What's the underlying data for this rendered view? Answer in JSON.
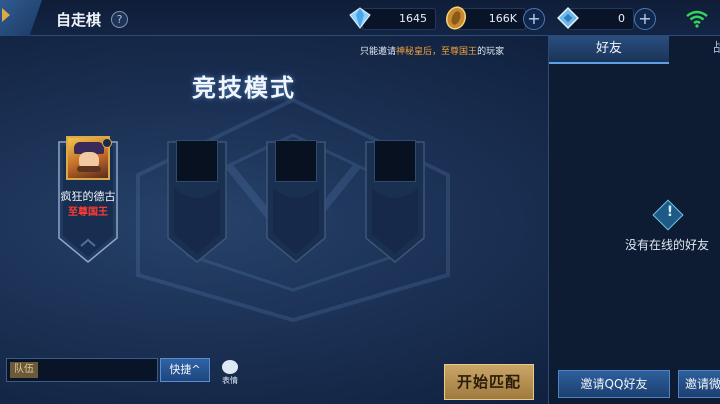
{
  "header": {
    "title": "自走棋",
    "help": "?",
    "diamonds": "1645",
    "gold": "166K",
    "crystals": "0",
    "colors": {
      "accent": "#d9a94a",
      "bar": "#132544"
    }
  },
  "notice": {
    "prefix": "只能邀请",
    "rank_a": "神秘皇后",
    "sep": "，",
    "rank_b": "至尊国王",
    "suffix": "的玩家"
  },
  "mode": {
    "title": "竞技模式"
  },
  "slots": [
    {
      "filled": true,
      "name": "疯狂的德古",
      "rank": "至尊国王"
    },
    {
      "filled": false
    },
    {
      "filled": false
    },
    {
      "filled": false
    }
  ],
  "chat": {
    "channel_tag": "队伍",
    "quick_label": "快捷",
    "quick_icon": "^",
    "emoji_label": "表情"
  },
  "start_button": "开始匹配",
  "friends": {
    "tab_active": "好友",
    "tab_inactive": "战",
    "empty_text": "没有在线的好友",
    "invite_qq": "邀请QQ好友",
    "invite_wechat": "邀请微"
  }
}
